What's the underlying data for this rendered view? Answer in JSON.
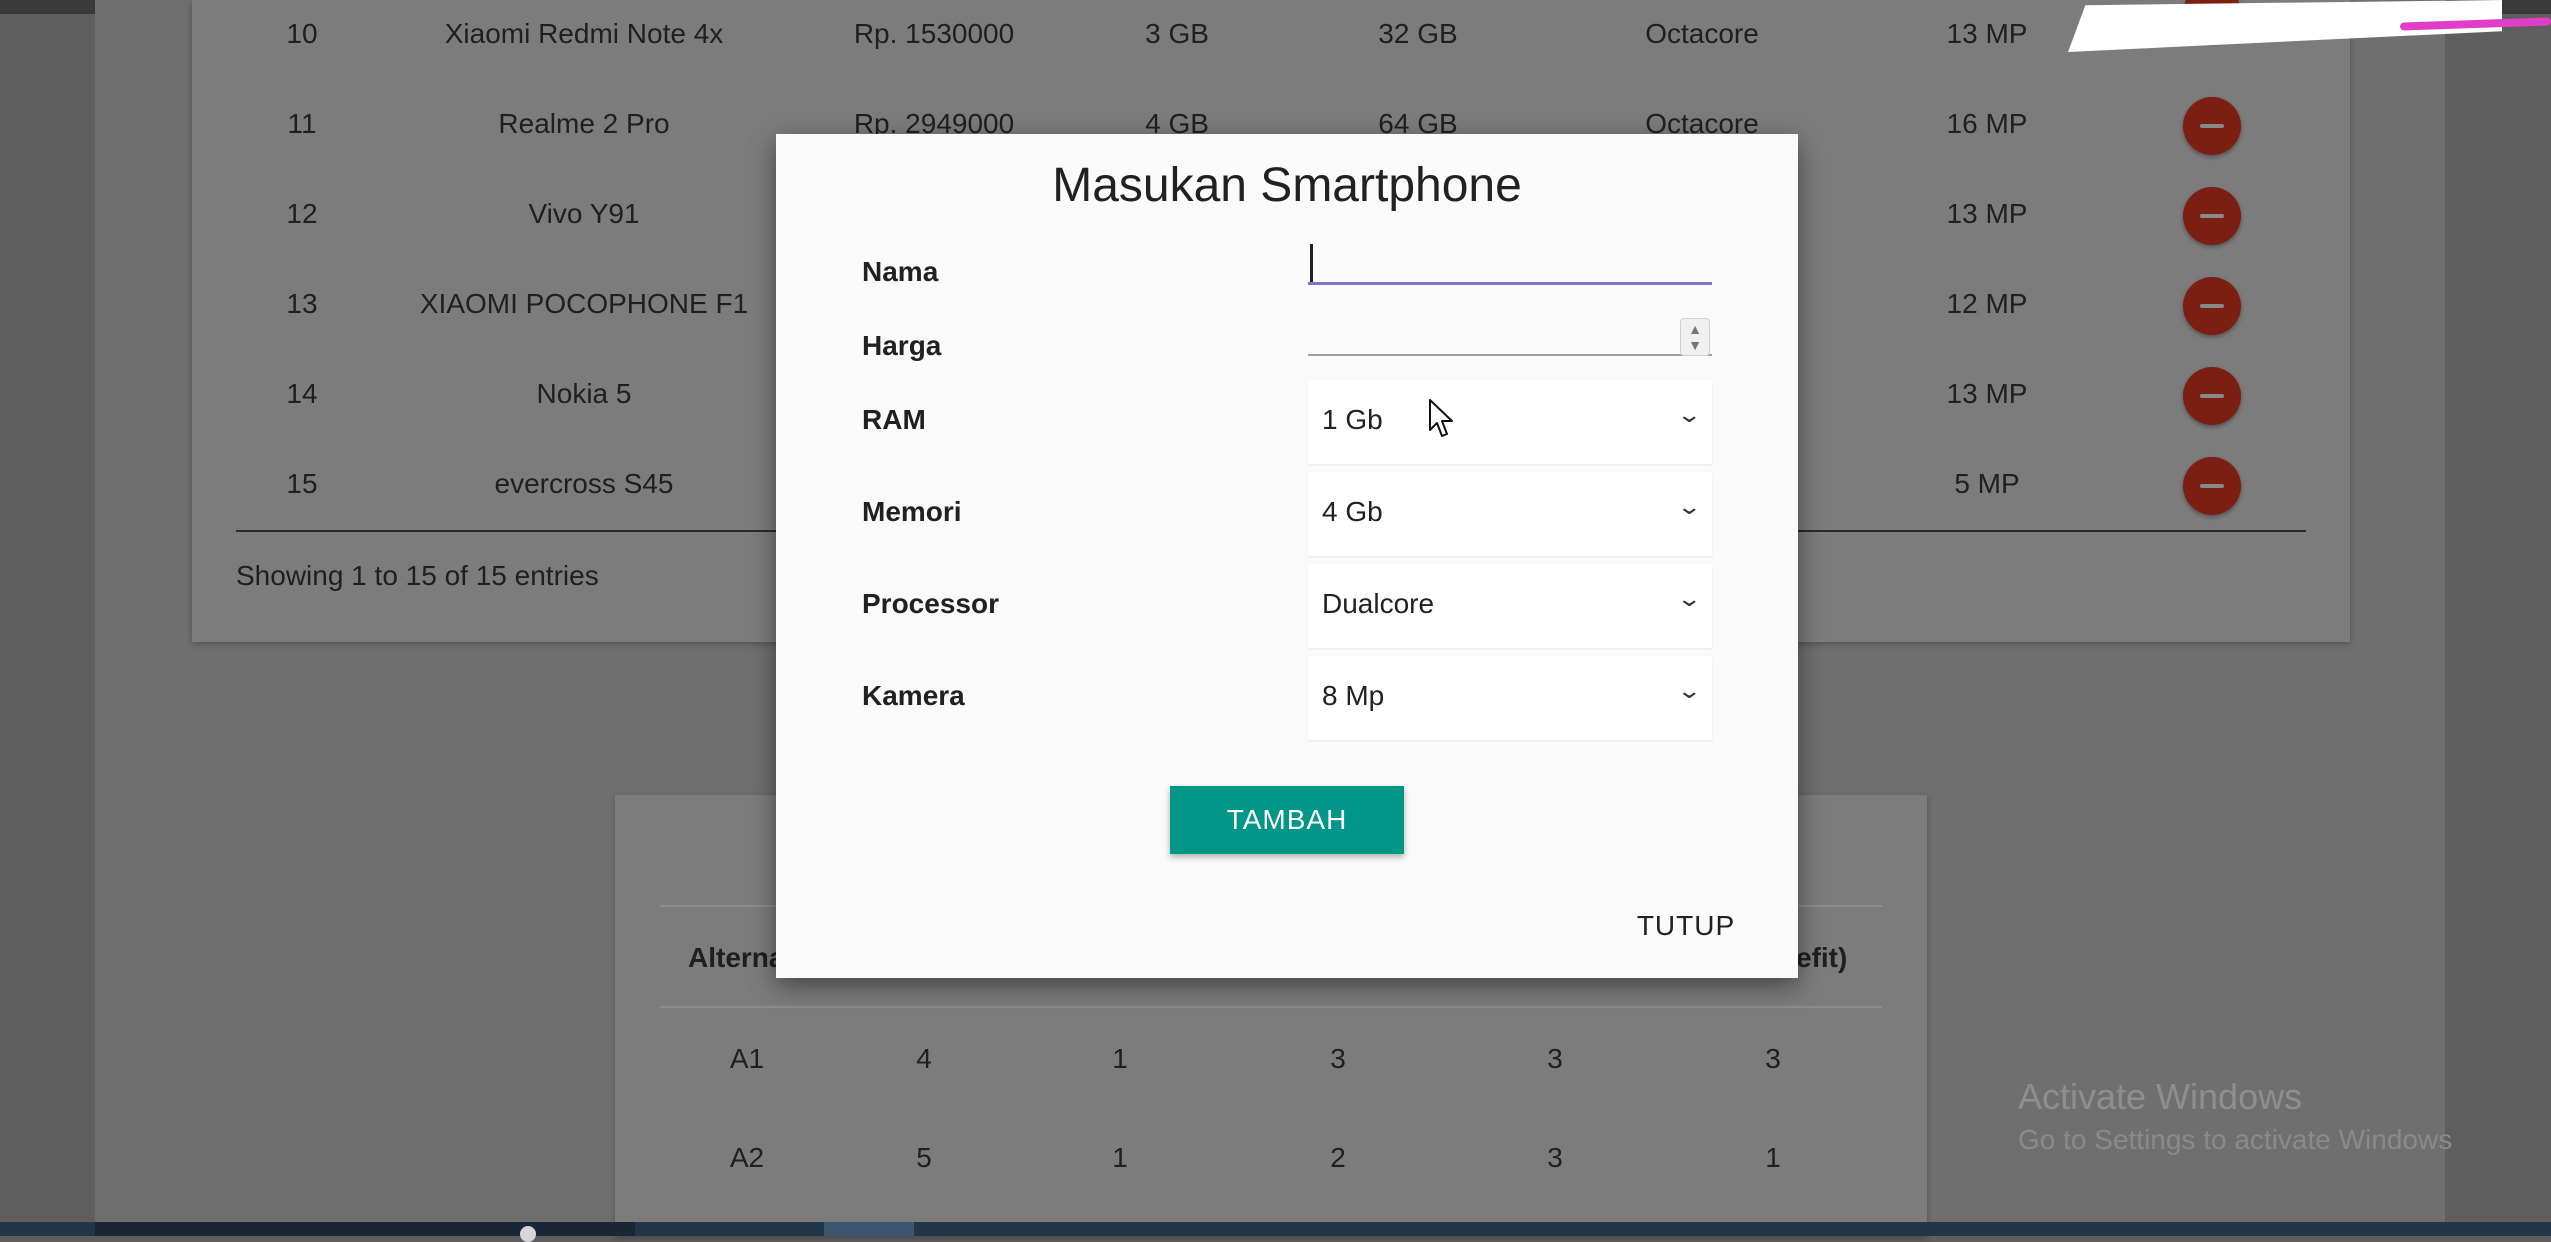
{
  "background_table": {
    "rows": [
      {
        "no": "10",
        "name": "Xiaomi Redmi Note 4x",
        "price": "Rp. 1530000",
        "ram": "3 GB",
        "memori": "32 GB",
        "processor": "Octacore",
        "kamera": "13 MP"
      },
      {
        "no": "11",
        "name": "Realme 2 Pro",
        "price": "Rp. 2949000",
        "ram": "4 GB",
        "memori": "64 GB",
        "processor": "Octacore",
        "kamera": "16 MP"
      },
      {
        "no": "12",
        "name": "Vivo Y91",
        "kamera": "13 MP"
      },
      {
        "no": "13",
        "name": "XIAOMI POCOPHONE F1",
        "kamera": "12 MP"
      },
      {
        "no": "14",
        "name": "Nokia 5",
        "kamera": "13 MP"
      },
      {
        "no": "15",
        "name": "evercross S45",
        "kamera": "5 MP"
      }
    ],
    "info": "Showing 1 to 15 of 15 entries"
  },
  "background_matrix": {
    "header_left": "Alterna",
    "header_right": "efit)",
    "rows": [
      {
        "alt": "A1",
        "values": [
          "4",
          "1",
          "3",
          "3",
          "3"
        ]
      },
      {
        "alt": "A2",
        "values": [
          "5",
          "1",
          "2",
          "3",
          "1"
        ]
      }
    ]
  },
  "modal": {
    "title": "Masukan Smartphone",
    "fields": {
      "nama": {
        "label": "Nama",
        "value": ""
      },
      "harga": {
        "label": "Harga",
        "value": ""
      },
      "ram": {
        "label": "RAM",
        "selected": "1 Gb"
      },
      "memori": {
        "label": "Memori",
        "selected": "4 Gb"
      },
      "processor": {
        "label": "Processor",
        "selected": "Dualcore"
      },
      "kamera": {
        "label": "Kamera",
        "selected": "8 Mp"
      }
    },
    "submit_label": "TAMBAH",
    "close_label": "TUTUP"
  },
  "watermark": {
    "line1": "Activate Windows",
    "line2": "Go to Settings to activate Windows"
  },
  "colors": {
    "primary": "#009688",
    "delete": "#c62828",
    "focus_underline": "#7e74c4"
  }
}
